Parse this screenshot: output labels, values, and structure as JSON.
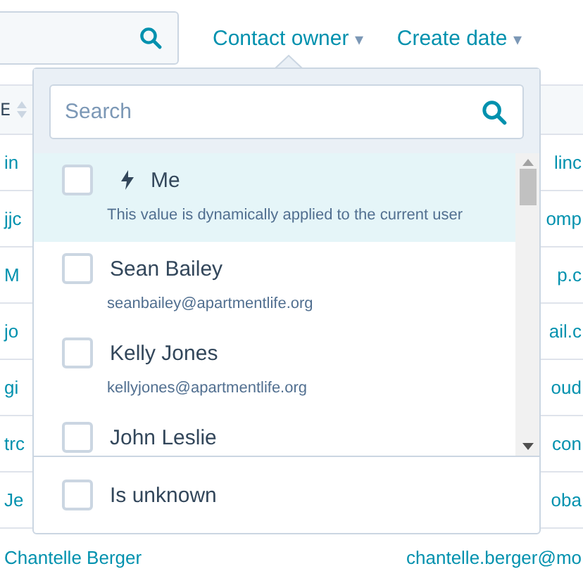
{
  "filters": [
    {
      "label": "Contact owner",
      "caret": "▾"
    },
    {
      "label": "Create date",
      "caret": "▾"
    }
  ],
  "table": {
    "header": "E",
    "rows": [
      {
        "column_1": "in",
        "column_2": "linc"
      },
      {
        "column_1": "jjc",
        "column_2": "omp"
      },
      {
        "column_1": "M",
        "column_2": "p.c"
      },
      {
        "column_1": "jo",
        "column_2": "ail.c"
      },
      {
        "column_1": "gi",
        "column_2": "oud"
      },
      {
        "column_1": "trc",
        "column_2": "con"
      },
      {
        "column_1": "Je",
        "column_2": "oba"
      },
      {
        "column_1": "Chantelle Berger",
        "column_2": "chantelle.berger@mo"
      }
    ]
  },
  "dropdown": {
    "search": {
      "placeholder": "Search"
    },
    "options": [
      {
        "kind": "dynamic",
        "name": "Me",
        "detail": "This value is dynamically applied to the current user",
        "checked": false,
        "highlighted": true
      },
      {
        "kind": "user",
        "name": "Sean Bailey",
        "detail": "seanbailey@apartmentlife.org",
        "checked": false,
        "highlighted": false
      },
      {
        "kind": "user",
        "name": "Kelly Jones",
        "detail": "kellyjones@apartmentlife.org",
        "checked": false,
        "highlighted": false
      },
      {
        "kind": "user",
        "name": "John Leslie",
        "checked": false,
        "highlighted": false
      }
    ],
    "footer": {
      "label": "Is unknown",
      "checked": false
    }
  }
}
